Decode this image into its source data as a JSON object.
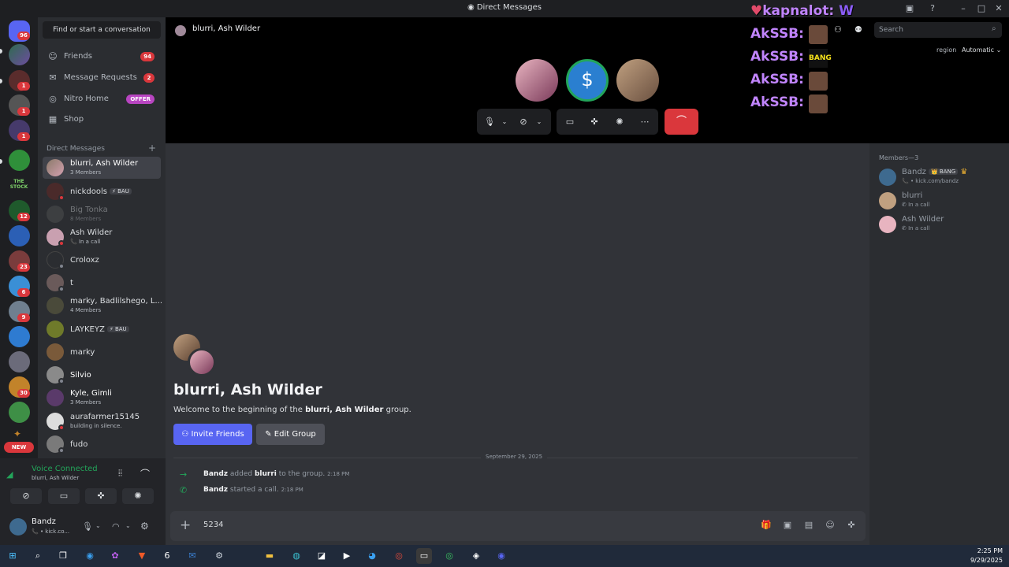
{
  "window": {
    "title": "Direct Messages"
  },
  "servers": {
    "badges": [
      "96",
      "1",
      "1",
      "1",
      "1",
      "12",
      "23",
      "6",
      "9",
      "30"
    ],
    "new_label": "NEW",
    "stock_label": "THE STOCK"
  },
  "sidebar": {
    "find_button": "Find or start a conversation",
    "nav": [
      {
        "label": "Friends",
        "badge": "94"
      },
      {
        "label": "Message Requests",
        "badge": "2"
      },
      {
        "label": "Nitro Home",
        "badge": "OFFER"
      },
      {
        "label": "Shop"
      }
    ],
    "dm_header": "Direct Messages",
    "dms": [
      {
        "name": "blurri, Ash Wilder",
        "sub": "3 Members"
      },
      {
        "name": "nickdools",
        "tag": "⚡ BAU"
      },
      {
        "name": "Big Tonka",
        "sub": "8 Members"
      },
      {
        "name": "Ash Wilder",
        "sub": "📞 In a call"
      },
      {
        "name": "Croloxz"
      },
      {
        "name": "t"
      },
      {
        "name": "marky, Badlilshego, L...",
        "sub": "4 Members"
      },
      {
        "name": "LAYKEYZ",
        "tag": "⚡ BAU"
      },
      {
        "name": "marky"
      },
      {
        "name": "Silvio"
      },
      {
        "name": "Kyle, Gimli",
        "sub": "3 Members"
      },
      {
        "name": "aurafarmer15145",
        "sub": "building in silence."
      },
      {
        "name": "fudo"
      }
    ]
  },
  "voice": {
    "status": "Voice Connected",
    "channel": "blurri, Ash Wilder"
  },
  "user": {
    "name": "Bandz",
    "sub": "📞 • kick.co..."
  },
  "header": {
    "title": "blurri, Ash Wilder",
    "search_placeholder": "Search",
    "region_label": "region",
    "region_value": "Automatic"
  },
  "overlay": {
    "first": "kapnalot:",
    "lines": [
      "AkSSB:",
      "AkSSB:",
      "AkSSB:",
      "AkSSB:"
    ],
    "bang": "BANG"
  },
  "members": {
    "header": "Members—3",
    "list": [
      {
        "name": "Bandz",
        "tag": "👑 BANG",
        "sub": "📞 • kick.com/bandz"
      },
      {
        "name": "blurri",
        "sub": "In a call"
      },
      {
        "name": "Ash Wilder",
        "sub": "In a call"
      }
    ]
  },
  "chat": {
    "title": "blurri, Ash Wilder",
    "welcome_pre": "Welcome to the beginning of the",
    "welcome_name": "blurri, Ash Wilder",
    "welcome_post": "group.",
    "invite": "Invite Friends",
    "edit": "Edit Group",
    "date": "September 29, 2025",
    "events": [
      {
        "actor": "Bandz",
        "text1": "added",
        "target": "blurri",
        "text2": "to the group.",
        "time": "2:18 PM"
      },
      {
        "actor": "Bandz",
        "text1": "started a call.",
        "time": "2:18 PM"
      }
    ],
    "composer_value": "5234"
  },
  "taskbar": {
    "time": "2:25 PM",
    "date": "9/29/2025"
  }
}
